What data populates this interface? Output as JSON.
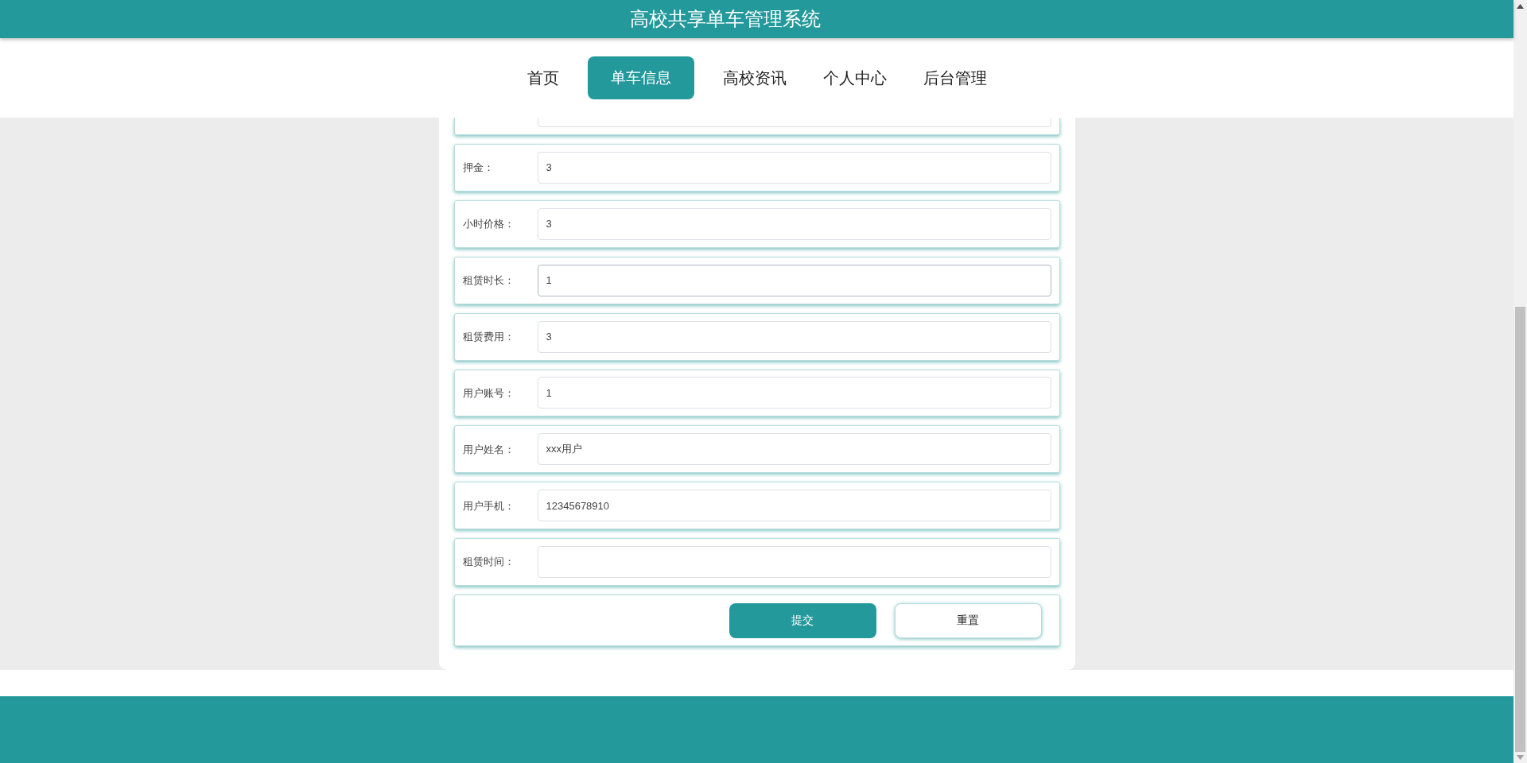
{
  "header": {
    "title": "高校共享单车管理系统"
  },
  "nav": [
    {
      "label": "首页",
      "selected": false
    },
    {
      "label": "单车信息",
      "selected": true
    },
    {
      "label": "高校资讯",
      "selected": false
    },
    {
      "label": "个人中心",
      "selected": false
    },
    {
      "label": "后台管理",
      "selected": false
    }
  ],
  "form": {
    "fields": [
      {
        "label": "押金：",
        "value": "3",
        "focused": false
      },
      {
        "label": "小时价格：",
        "value": "3",
        "focused": false
      },
      {
        "label": "租赁时长：",
        "value": "1",
        "focused": true
      },
      {
        "label": "租赁费用：",
        "value": "3",
        "focused": false
      },
      {
        "label": "用户账号：",
        "value": "1",
        "focused": false
      },
      {
        "label": "用户姓名：",
        "value": "xxx用户",
        "focused": false
      },
      {
        "label": "用户手机：",
        "value": "12345678910",
        "focused": false
      },
      {
        "label": "租赁时间：",
        "focused": false
      }
    ],
    "buttons": [
      {
        "label": "提交",
        "kind": "primary"
      },
      {
        "label": "重置",
        "kind": "secondary"
      }
    ]
  }
}
